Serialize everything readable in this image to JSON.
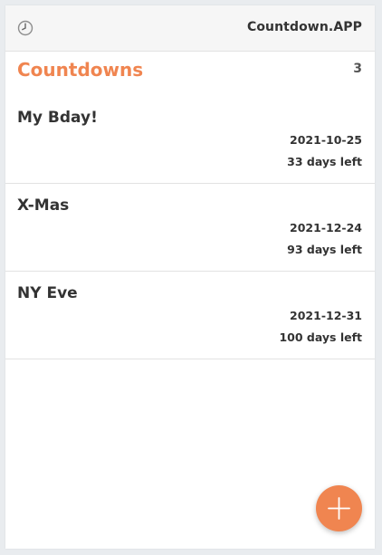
{
  "header": {
    "app_title": "Countdown.APP",
    "icon": "clock-icon"
  },
  "section": {
    "title": "Countdowns",
    "count": "3"
  },
  "countdowns": [
    {
      "name": "My Bday!",
      "date": "2021-10-25",
      "days_left": "33 days left"
    },
    {
      "name": "X-Mas",
      "date": "2021-12-24",
      "days_left": "93 days left"
    },
    {
      "name": "NY Eve",
      "date": "2021-12-31",
      "days_left": "100 days left"
    }
  ],
  "fab": {
    "icon": "plus-icon"
  },
  "colors": {
    "accent": "#f08550",
    "text": "#333333",
    "header_bg": "#f6f6f6"
  }
}
